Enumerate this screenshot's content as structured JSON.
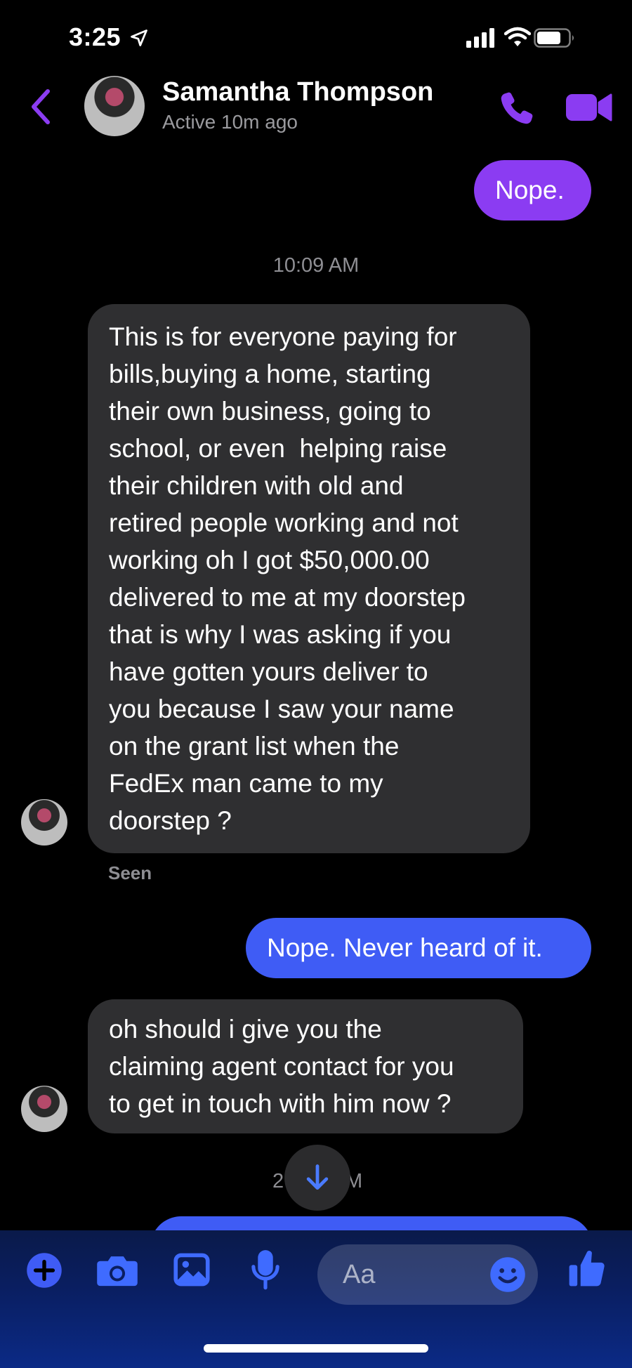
{
  "status_bar": {
    "time": "3:25"
  },
  "header": {
    "name": "Samantha Thompson",
    "status": "Active 10m ago"
  },
  "messages": {
    "m1": "Nope.",
    "timestamp1": "10:09 AM",
    "m2_lines": [
      "This is for everyone paying for",
      "bills,buying a home, starting",
      "their own business, going to",
      "school, or even  helping raise",
      "their children with old and",
      "retired people working and not",
      "working oh I got $50,000.00",
      "delivered to me at my doorstep",
      "that is why I was asking if you",
      "have gotten yours deliver to",
      "you because I saw your name",
      "on the grant list when the",
      "FedEx man came to my",
      "doorstep ?"
    ],
    "seen": "Seen",
    "m3": "Nope. Never heard of it.",
    "m4_lines": [
      "oh should i give you the",
      "claiming agent contact for you",
      "to get in touch with him now ?"
    ],
    "timestamp2_left": "2",
    "timestamp2_right": "M"
  },
  "composer": {
    "placeholder": "Aa"
  },
  "colors": {
    "accent_purple": "#8b3cf2",
    "accent_blue": "#3f5cf5",
    "incoming_bubble": "#2f2f31"
  }
}
